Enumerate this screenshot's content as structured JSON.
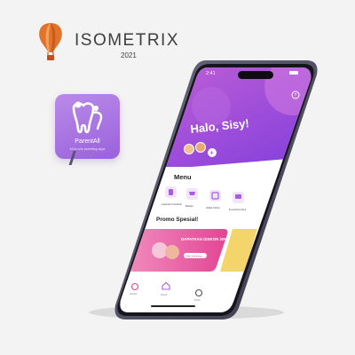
{
  "brand": {
    "name": "ISOMETRIX",
    "year": "2021",
    "icon": "hot-air-balloon-logo",
    "colors": {
      "balloon": "#e2732c",
      "basket": "#c04f1f"
    }
  },
  "app_icon": {
    "name": "ParentAll",
    "tagline": "All-in-one parenting apps",
    "icon": "tooth-family-icon",
    "color": "#a56fe0"
  },
  "phone": {
    "status_time": "2:41",
    "greeting": "Halo, Sisy!",
    "menu_title": "Menu",
    "menu_items": [
      {
        "label": "Layanan Konsultasi",
        "icon": "consultation-icon"
      },
      {
        "label": "Belanja",
        "icon": "cart-icon"
      },
      {
        "label": "Artikel Library",
        "icon": "book-icon"
      },
      {
        "label": "E-Learning Zone",
        "icon": "elearning-icon"
      }
    ],
    "promo_title": "Promo Spesial!",
    "promo_banner": {
      "text": "DAPATKAN DISKON 20%",
      "button": "Beli Sekarang"
    },
    "nav": [
      {
        "label": "Konsul",
        "icon": "consult-nav-icon"
      },
      {
        "label": "Home",
        "icon": "home-nav-icon"
      },
      {
        "label": "Profil",
        "icon": "profile-nav-icon"
      }
    ],
    "colors": {
      "accent": "#a85ce0",
      "header_top": "#c05fd7",
      "header_bottom": "#8a3fe0",
      "promo": "#e4479a",
      "frame": "#4b4a5e"
    }
  }
}
